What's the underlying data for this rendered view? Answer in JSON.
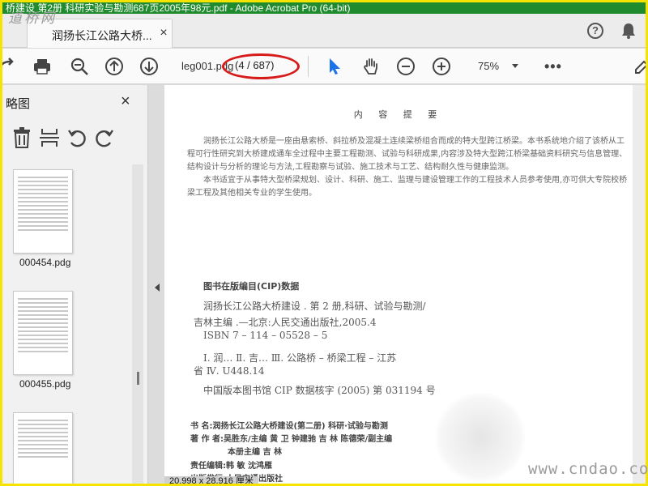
{
  "window": {
    "title": "桥建设 第2册 科研实验与勘测687页2005年98元.pdf - Adobe Acrobat Pro (64-bit)"
  },
  "watermarks": {
    "top_left": "道桥网",
    "bottom_right": "www.cndao.com"
  },
  "tab": {
    "label": "润扬长江公路大桥...",
    "close": "×"
  },
  "header_icons": {
    "help": "?",
    "help_icon": "help-icon",
    "bell_icon": "bell-icon"
  },
  "toolbar": {
    "file_name": "leg001.pdg",
    "page_indicator": "(4 / 687)",
    "zoom": "75%",
    "more": "•••",
    "icons": [
      "print-icon",
      "zoom-out-search-icon",
      "page-up-icon",
      "page-down-icon",
      "select-arrow-icon",
      "hand-icon",
      "zoom-out-icon",
      "zoom-in-icon"
    ]
  },
  "sidebar": {
    "title": "略图",
    "close": "×",
    "tools": [
      "trash-icon",
      "extract-icon",
      "rotate-left-icon",
      "rotate-right-icon"
    ],
    "thumbnails": [
      {
        "label": "000454.pdg"
      },
      {
        "label": "000455.pdg"
      },
      {
        "label": ""
      }
    ]
  },
  "document": {
    "heading": "内 容 提 要",
    "paragraph1": "润扬长江公路大桥是一座由悬索桥、斜拉桥及混凝土连续梁桥组合而成的特大型跨江桥梁。本书系统地介绍了该桥从工程可行性研究到大桥建成通车全过程中主要工程勘测、试验与科研成果,内容涉及特大型跨江桥梁基础资料研究与信息管理、结构设计与分析的理论与方法,工程勘察与试验、施工技术与工艺、结构耐久性与健康监测。",
    "paragraph2": "本书适宜于从事特大型桥梁规划、设计、科研、施工、监理与建设管理工作的工程技术人员参考使用,亦可供大专院校桥梁工程及其他相关专业的学生使用。",
    "cip_title": "图书在版编目(CIP)数据",
    "cip_line1": "润扬长江公路大桥建设 . 第 2 册,科研、试验与勘测/",
    "cip_line2": "吉林主编 .—北京:人民交通出版社,2005.4",
    "cip_line3": "ISBN 7 – 114 – 05528 – 5",
    "cip_line4": "Ⅰ. 润…   Ⅱ. 吉…   Ⅲ. 公路桥 – 桥梁工程 – 江苏",
    "cip_line5": "省   Ⅳ. U448.14",
    "cip_line6": "中国版本图书馆 CIP 数据核字 (2005) 第 031194 号",
    "info_book": "书    名:润扬长江公路大桥建设(第二册)  科研·试验与勘测",
    "info_authors": "著 作 者:吴胜东/主编   黄  卫   钟建驰   吉  林   陈德荣/副主编",
    "info_authors2": "本册主编   吉  林",
    "info_editor": "责任编辑:韩   敏   沈鸿雁",
    "info_publisher": "出版发行:人民交通出版社",
    "page_size": "20.998 x 28.916 厘米"
  },
  "colors": {
    "title_bar": "#1f8b2e",
    "frame": "#f6e400",
    "highlight_oval": "#d71b1b",
    "select_tool": "#1a73e8"
  }
}
